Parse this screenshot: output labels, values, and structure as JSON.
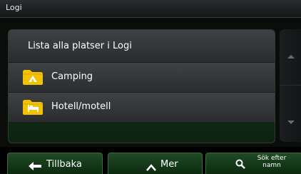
{
  "title": "Logi",
  "list": {
    "header": "Lista alla platser i Logi",
    "items": [
      {
        "label": "Camping",
        "icon": "camping-tent-icon"
      },
      {
        "label": "Hotell/motell",
        "icon": "hotel-bed-icon"
      }
    ]
  },
  "buttons": {
    "back": "Tillbaka",
    "more": "Mer",
    "search": "Sök efter namn"
  },
  "colors": {
    "folder": "#f2c200",
    "panel_green": "#15361a",
    "row_gray": "#3f4244"
  }
}
